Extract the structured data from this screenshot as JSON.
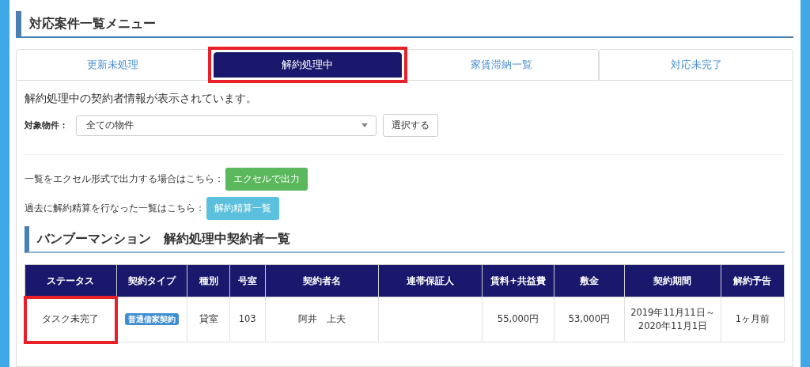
{
  "menu_title": "対応案件一覧メニュー",
  "tabs": [
    {
      "label": "更新未処理",
      "selected": false,
      "highlighted": false
    },
    {
      "label": "解約処理中",
      "selected": true,
      "highlighted": true
    },
    {
      "label": "家賃滞納一覧",
      "selected": false,
      "highlighted": false
    },
    {
      "label": "対応未完了",
      "selected": false,
      "highlighted": false
    }
  ],
  "description": "解約処理中の契約者情報が表示されています。",
  "filter": {
    "label": "対象物件：",
    "value": "全ての物件",
    "button": "選択する"
  },
  "actions": [
    {
      "text": "一覧をエクセル形式で出力する場合はこちら：",
      "button": "エクセルで出力",
      "kind": "success"
    },
    {
      "text": "過去に解約精算を行なった一覧はこちら：",
      "button": "解約精算一覧",
      "kind": "info"
    }
  ],
  "list_title": "バンブーマンション　解約処理中契約者一覧",
  "table": {
    "columns": [
      "ステータス",
      "契約タイプ",
      "種別",
      "号室",
      "契約者名",
      "連帯保証人",
      "賃料+共益費",
      "敷金",
      "契約期間",
      "解約予告"
    ],
    "rows": [
      {
        "status": "タスク未完了",
        "status_highlighted": true,
        "contract_type": "普通借家契約",
        "category": "貸室",
        "room": "103",
        "name": "阿井　上夫",
        "guarantor": "",
        "rent": "55,000円",
        "deposit": "53,000円",
        "period": [
          "2019年11月11日～",
          "2020年11月1日"
        ],
        "notice": "1ヶ月前"
      }
    ]
  }
}
